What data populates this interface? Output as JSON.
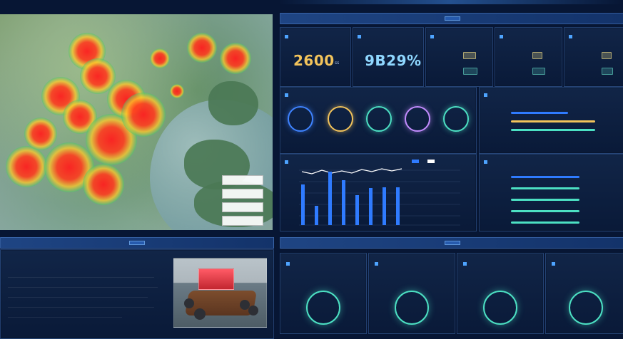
{
  "colors": {
    "bg": "#071634",
    "panel": "#0f2548",
    "accent_blue": "#2f7bff",
    "accent_gold": "#f2c35b",
    "accent_teal": "#4ce0c3",
    "accent_purple": "#c38cff"
  },
  "top_right": {
    "kpis": [
      {
        "value": "2600",
        "unit": "ss",
        "color": "#f2c35b"
      },
      {
        "value": "9B29%",
        "color": "#8fd7ff"
      }
    ]
  },
  "map": {
    "legend_items": [
      "",
      "",
      "",
      ""
    ]
  },
  "bottom_left": {
    "headline": "",
    "paragraph_lines": [
      "",
      "",
      "",
      "",
      ""
    ]
  }
}
